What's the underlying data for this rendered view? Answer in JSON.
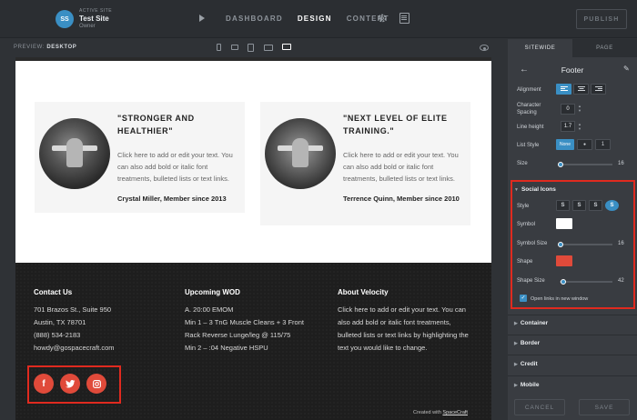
{
  "topbar": {
    "site_initials": "SS",
    "active_site_label": "ACTIVE SITE",
    "site_name": "Test Site",
    "site_role": "Owner",
    "nav": [
      {
        "label": "DASHBOARD",
        "active": false
      },
      {
        "label": "DESIGN",
        "active": true
      },
      {
        "label": "CONTENT",
        "active": false
      }
    ],
    "publish_label": "PUBLISH"
  },
  "previewbar": {
    "label": "PREVIEW:",
    "mode": "DESKTOP"
  },
  "testimonials": [
    {
      "quote": "\"STRONGER AND HEALTHIER\"",
      "body": "Click here to add or edit your text. You can also add bold or italic font treatments, bulleted lists or text links.",
      "author": "Crystal Miller, Member since 2013"
    },
    {
      "quote": "\"NEXT LEVEL OF ELITE TRAINING.\"",
      "body": "Click here to add or edit your text. You can also add bold or italic font treatments, bulleted lists or text links.",
      "author": "Terrence Quinn, Member since 2010"
    }
  ],
  "footer": {
    "contact": {
      "title": "Contact Us",
      "lines": [
        "701 Brazos St., Suite 950",
        "Austin, TX 78701",
        "(888) 534-2183",
        "howdy@gospacecraft.com"
      ]
    },
    "wod": {
      "title": "Upcoming WOD",
      "lines": [
        "A. 20:00 EMOM",
        "Min 1 – 3 TnG Muscle Cleans + 3 Front",
        "Rack Reverse Lunge/leg @ 115/75",
        "Min 2 – :04 Negative HSPU"
      ]
    },
    "about": {
      "title": "About Velocity",
      "body": "Click here to add or edit your text. You can also add bold or italic font treatments, bulleted lists or text links by highlighting the text you would like to change."
    },
    "social_glyphs": [
      "f",
      "t",
      "i"
    ],
    "credit_prefix": "Created with",
    "credit_link": "SpaceCraft"
  },
  "panel": {
    "tabs": [
      {
        "label": "SITEWIDE",
        "active": true
      },
      {
        "label": "PAGE",
        "active": false
      }
    ],
    "title": "Footer",
    "alignment_label": "Alignment",
    "char_spacing_label": "Character Spacing",
    "char_spacing_value": "0",
    "line_height_label": "Line height",
    "line_height_value": "1.7",
    "list_style_label": "List Style",
    "list_style_none": "None",
    "list_style_bullet": "●",
    "list_style_number": "1",
    "size_label": "Size",
    "size_value": "16",
    "size_level": 0.0,
    "social_icons_label": "Social Icons",
    "style_label": "Style",
    "style_glyph": "S",
    "symbol_label": "Symbol",
    "symbol_color": "#ffffff",
    "symbol_size_label": "Symbol Size",
    "symbol_size_value": "16",
    "shape_label": "Shape",
    "shape_color": "#e04a3a",
    "shape_size_label": "Shape Size",
    "shape_size_value": "42",
    "open_links_label": "Open links in new window",
    "sections": [
      "Container",
      "Border",
      "Credit",
      "Mobile"
    ],
    "cancel_label": "CANCEL",
    "save_label": "SAVE"
  }
}
